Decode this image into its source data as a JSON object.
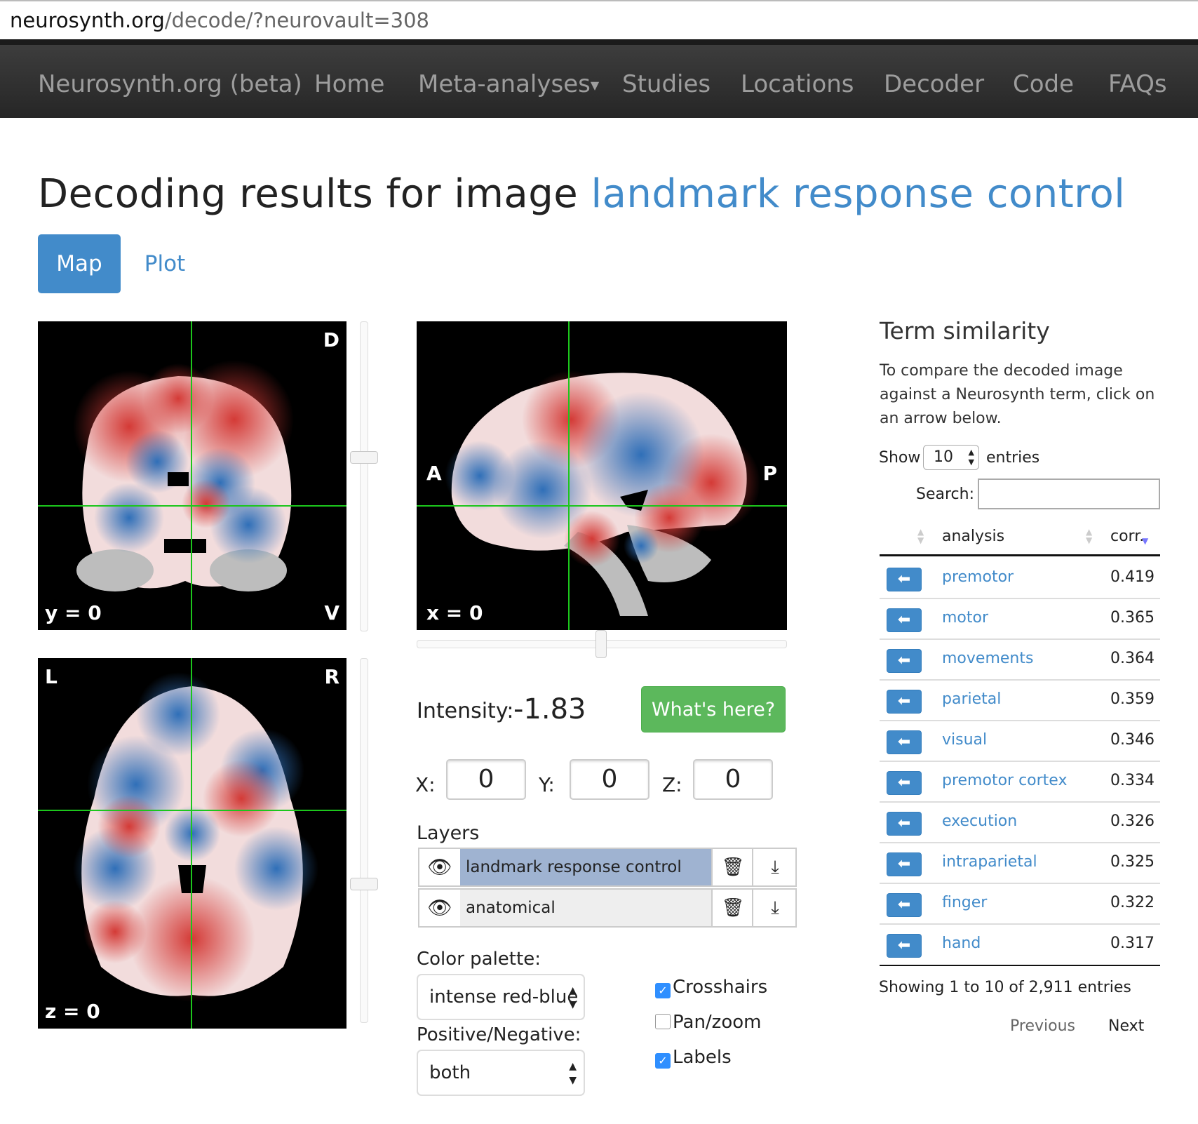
{
  "browser": {
    "url_host": "neurosynth.org",
    "url_path": "/decode/?neurovault=308"
  },
  "navbar": {
    "brand": "Neurosynth.org (beta)",
    "items": [
      {
        "label": "Home"
      },
      {
        "label": "Meta-analyses"
      },
      {
        "label": "Studies"
      },
      {
        "label": "Locations"
      },
      {
        "label": "Decoder"
      },
      {
        "label": "Code"
      },
      {
        "label": "FAQs"
      }
    ]
  },
  "page": {
    "title_prefix": "Decoding results for image",
    "title_link": "landmark response control",
    "tabs": [
      {
        "label": "Map",
        "active": true
      },
      {
        "label": "Plot",
        "active": false
      }
    ]
  },
  "viewer": {
    "coronal": {
      "slice_label": "y = 0",
      "top_right": "D",
      "bottom_right": "V"
    },
    "sagittal": {
      "slice_label": "x = 0",
      "left": "A",
      "right": "P"
    },
    "axial": {
      "slice_label": "z = 0",
      "top_left": "L",
      "top_right": "R"
    },
    "colors": {
      "crosshair": "#1cc61c",
      "positive": "#d43a36",
      "negative": "#2f6fb8"
    }
  },
  "controls": {
    "intensity_label": "Intensity:",
    "intensity_value": "-1.83",
    "whats_here": "What's here?",
    "x_label": "X:",
    "x_value": "0",
    "y_label": "Y:",
    "y_value": "0",
    "z_label": "Z:",
    "z_value": "0",
    "layers_label": "Layers",
    "layers": [
      {
        "name": "landmark response control",
        "selected": true
      },
      {
        "name": "anatomical",
        "selected": false
      }
    ],
    "palette_label": "Color palette:",
    "palette_value": "intense red-blue",
    "posneg_label": "Positive/Negative:",
    "posneg_value": "both",
    "checkboxes": [
      {
        "label": "Crosshairs",
        "checked": true
      },
      {
        "label": "Pan/zoom",
        "checked": false
      },
      {
        "label": "Labels",
        "checked": true
      }
    ]
  },
  "term_similarity": {
    "title": "Term similarity",
    "description": "To compare the decoded image against a Neurosynth term, click on an arrow below.",
    "show_label": "Show",
    "show_value": "10",
    "entries_label": "entries",
    "search_label": "Search:",
    "search_value": "",
    "columns": [
      "analysis",
      "corr."
    ],
    "rows": [
      {
        "term": "premotor",
        "corr": "0.419"
      },
      {
        "term": "motor",
        "corr": "0.365"
      },
      {
        "term": "movements",
        "corr": "0.364"
      },
      {
        "term": "parietal",
        "corr": "0.359"
      },
      {
        "term": "visual",
        "corr": "0.346"
      },
      {
        "term": "premotor cortex",
        "corr": "0.334"
      },
      {
        "term": "execution",
        "corr": "0.326"
      },
      {
        "term": "intraparietal",
        "corr": "0.325"
      },
      {
        "term": "finger",
        "corr": "0.322"
      },
      {
        "term": "hand",
        "corr": "0.317"
      }
    ],
    "showing_text": "Showing 1 to 10 of 2,911 entries",
    "previous": "Previous",
    "next": "Next"
  }
}
